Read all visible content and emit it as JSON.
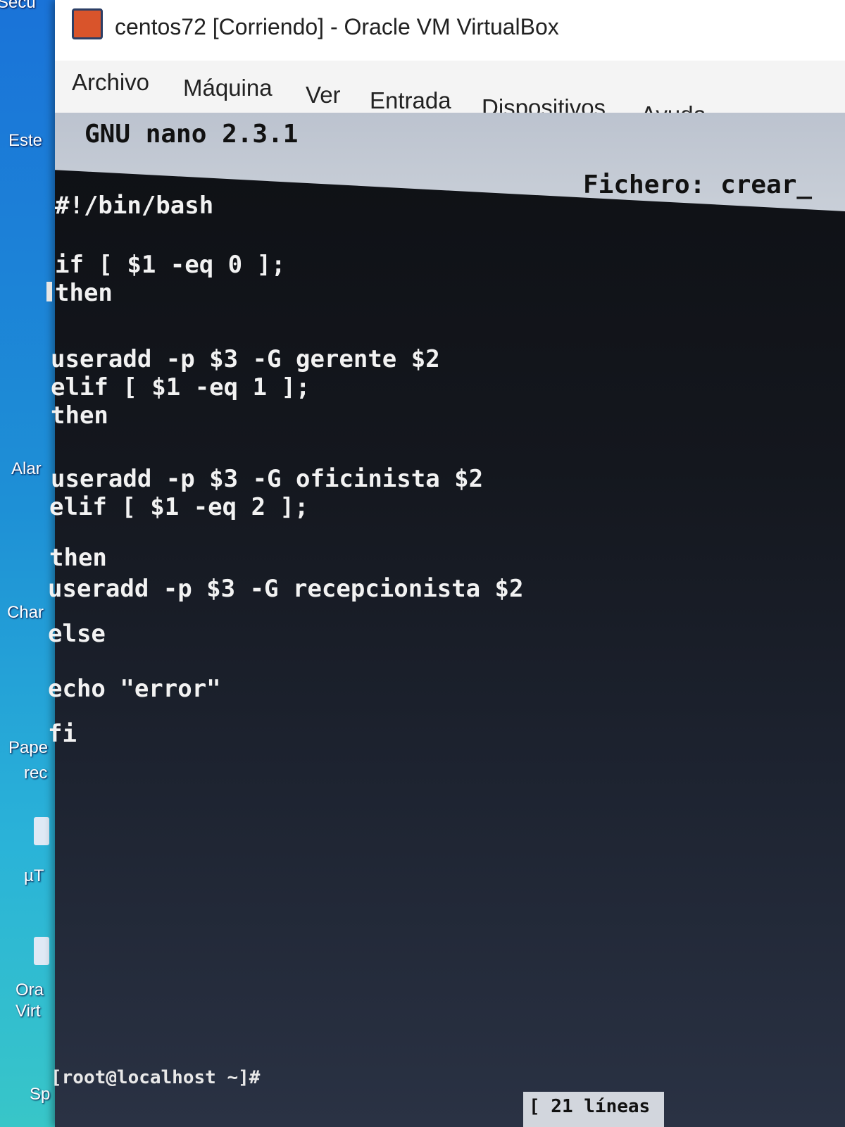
{
  "window": {
    "title": "centos72 [Corriendo] - Oracle VM VirtualBox"
  },
  "menu": [
    "Archivo",
    "Máquina",
    "Ver",
    "Entrada",
    "Dispositivos",
    "Ayuda"
  ],
  "nano": {
    "version": "GNU nano 2.3.1",
    "file_label": "Fichero: crear_",
    "status": "[ 21 líneas"
  },
  "code": [
    "#!/bin/bash",
    "if [ $1 -eq 0 ];",
    "then",
    "useradd -p $3 -G gerente $2",
    "elif [ $1 -eq 1 ];",
    "then",
    "useradd -p $3 -G oficinista $2",
    "elif [ $1 -eq 2 ];",
    "then",
    "useradd -p $3 -G recepcionista $2",
    "else",
    "echo \"error\"",
    "fi"
  ],
  "prompt": "[root@localhost ~]#",
  "desktop": {
    "labels": [
      "Este",
      "Alar",
      "Char",
      "Pape",
      "rec",
      "µT",
      "Ora",
      "Virt",
      "Sp",
      "Secu"
    ]
  }
}
